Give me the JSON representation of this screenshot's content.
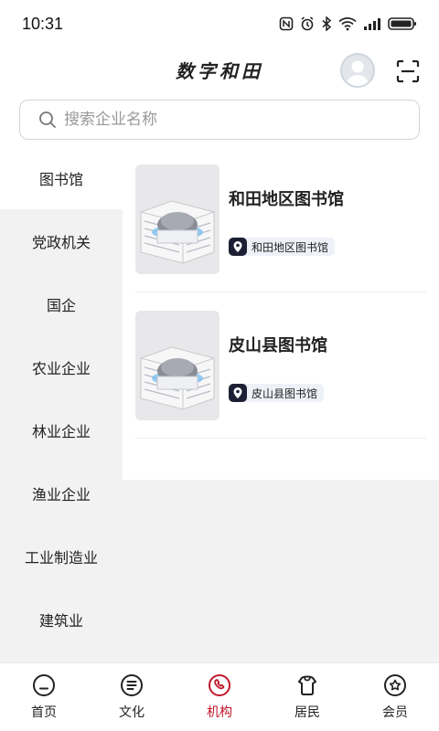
{
  "status_bar": {
    "time": "10:31"
  },
  "header": {
    "title": "数字和田"
  },
  "search": {
    "placeholder": "搜索企业名称",
    "value": ""
  },
  "sidebar": {
    "items": [
      {
        "label": "图书馆",
        "active": true
      },
      {
        "label": "党政机关"
      },
      {
        "label": "国企"
      },
      {
        "label": "农业企业"
      },
      {
        "label": "林业企业"
      },
      {
        "label": "渔业企业"
      },
      {
        "label": "工业制造业"
      },
      {
        "label": "建筑业"
      }
    ]
  },
  "cards": [
    {
      "title": "和田地区图书馆",
      "tag": "和田地区图书馆"
    },
    {
      "title": "皮山县图书馆",
      "tag": "皮山县图书馆"
    }
  ],
  "tabbar": {
    "items": [
      {
        "label": "首页",
        "icon": "home-icon"
      },
      {
        "label": "文化",
        "icon": "culture-icon"
      },
      {
        "label": "机构",
        "icon": "institution-icon",
        "active": true
      },
      {
        "label": "居民",
        "icon": "resident-icon"
      },
      {
        "label": "会员",
        "icon": "member-icon"
      }
    ],
    "active_color": "#c0172a"
  }
}
